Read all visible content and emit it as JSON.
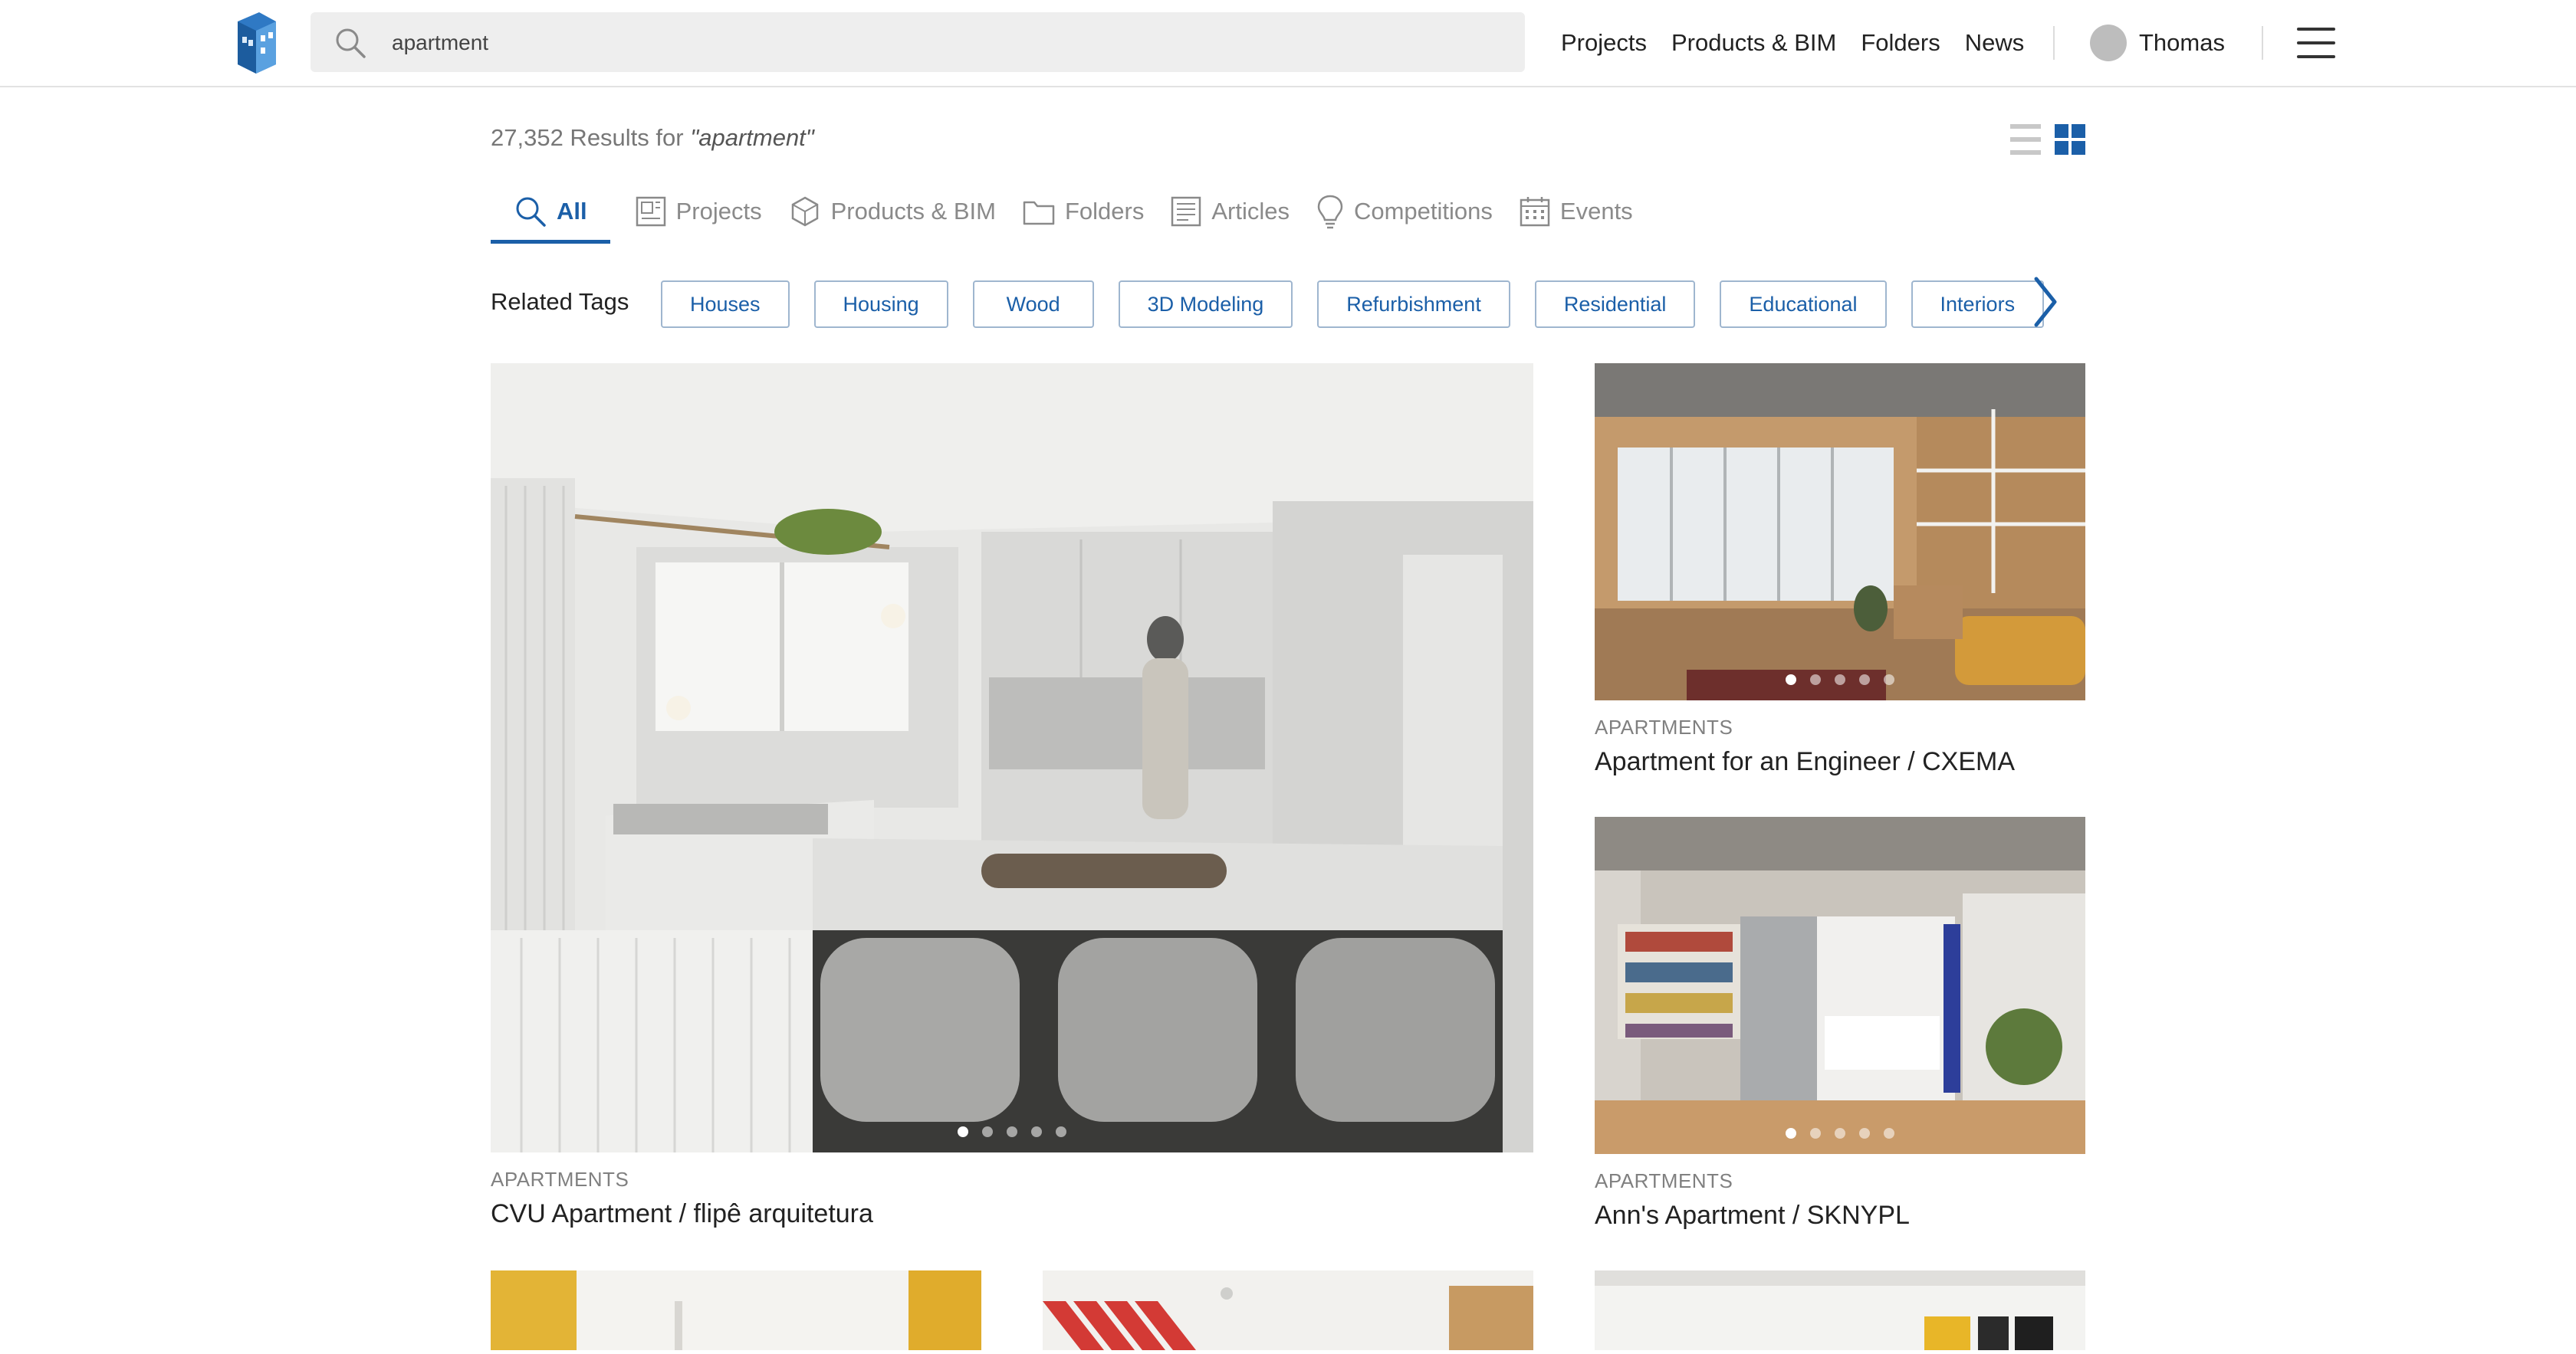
{
  "header": {
    "search_value": "apartment",
    "nav": [
      "Projects",
      "Products & BIM",
      "Folders",
      "News"
    ],
    "user_name": "Thomas"
  },
  "results": {
    "count_text": "27,352 Results for",
    "query_text": "\"apartment\""
  },
  "tabs": [
    {
      "label": "All",
      "icon": "search-icon",
      "active": true
    },
    {
      "label": "Projects",
      "icon": "projects-icon",
      "active": false
    },
    {
      "label": "Products & BIM",
      "icon": "products-icon",
      "active": false
    },
    {
      "label": "Folders",
      "icon": "folder-icon",
      "active": false
    },
    {
      "label": "Articles",
      "icon": "articles-icon",
      "active": false
    },
    {
      "label": "Competitions",
      "icon": "lightbulb-icon",
      "active": false
    },
    {
      "label": "Events",
      "icon": "calendar-icon",
      "active": false
    }
  ],
  "tags": {
    "label": "Related Tags",
    "items": [
      "Houses",
      "Housing",
      "Wood",
      "3D Modeling",
      "Refurbishment",
      "Residential",
      "Educational",
      "Interiors"
    ]
  },
  "cards": [
    {
      "category": "APARTMENTS",
      "title": "CVU Apartment / flipê arquitetura"
    },
    {
      "category": "APARTMENTS",
      "title": "Apartment for an Engineer / CXEMA"
    },
    {
      "category": "APARTMENTS",
      "title": "Ann's Apartment / SKNYPL"
    }
  ],
  "colors": {
    "accent": "#1b5fa8",
    "search_bg": "#eeeeee",
    "tag_border": "#9fb6cf"
  }
}
